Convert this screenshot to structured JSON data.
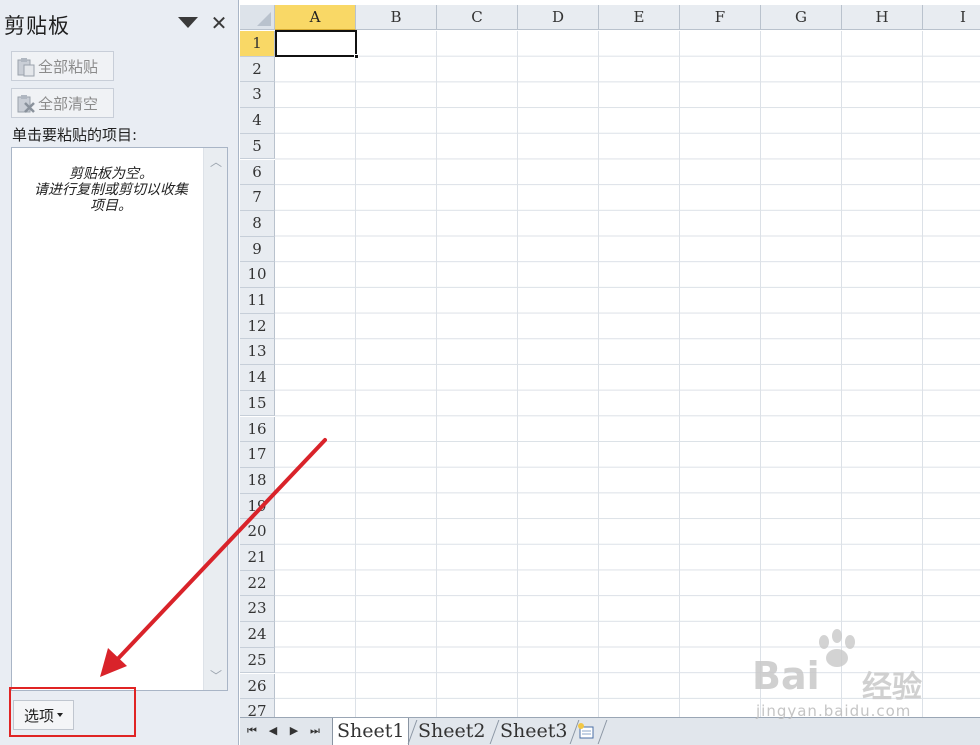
{
  "clipboard_pane": {
    "title": "剪贴板",
    "paste_all_label": "全部粘贴",
    "clear_all_label": "全部清空",
    "instruction": "单击要粘贴的项目:",
    "empty_message": "剪贴板为空。\n请进行复制或剪切以收集\n项目。",
    "options_label": "选项"
  },
  "spreadsheet": {
    "columns": [
      "A",
      "B",
      "C",
      "D",
      "E",
      "F",
      "G",
      "H",
      "I"
    ],
    "rows": [
      "1",
      "2",
      "3",
      "4",
      "5",
      "6",
      "7",
      "8",
      "9",
      "10",
      "11",
      "12",
      "13",
      "14",
      "15",
      "16",
      "17",
      "18",
      "19",
      "20",
      "21",
      "22",
      "23",
      "24",
      "25",
      "26",
      "27"
    ],
    "active_cell": "A1"
  },
  "sheet_tabs": [
    "Sheet1",
    "Sheet2",
    "Sheet3"
  ],
  "watermark": {
    "brand": "Bai",
    "brand_cn": "经验",
    "url": "jingyan.baidu.com"
  },
  "colors": {
    "accent_highlight": "#e02424",
    "active_header": "#f9d866"
  }
}
